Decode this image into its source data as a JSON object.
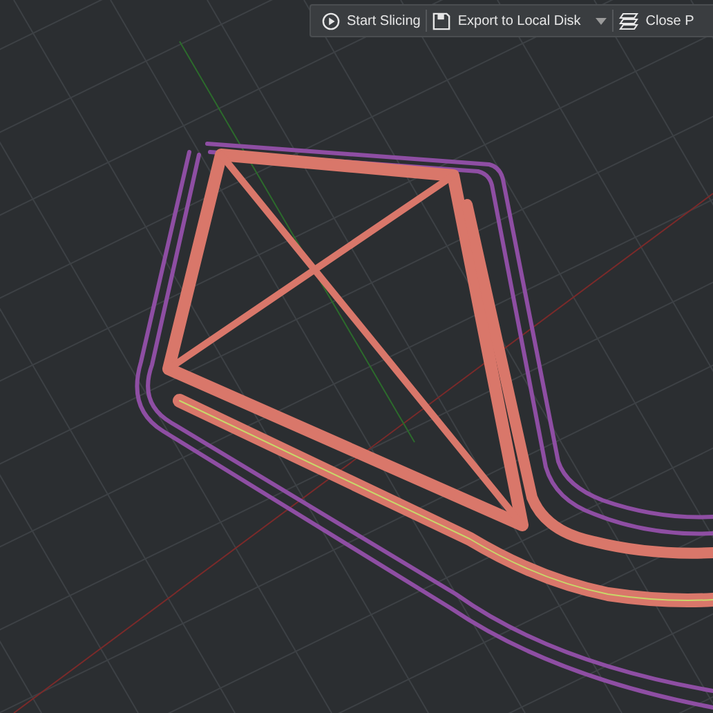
{
  "toolbar": {
    "buttons": [
      {
        "label": "Start Slicing",
        "kind": "play",
        "has_menu": false
      },
      {
        "label": "Export to Local Disk",
        "kind": "disk",
        "has_menu": true
      },
      {
        "label": "Close P",
        "kind": "layers",
        "has_menu": false
      }
    ]
  }
}
